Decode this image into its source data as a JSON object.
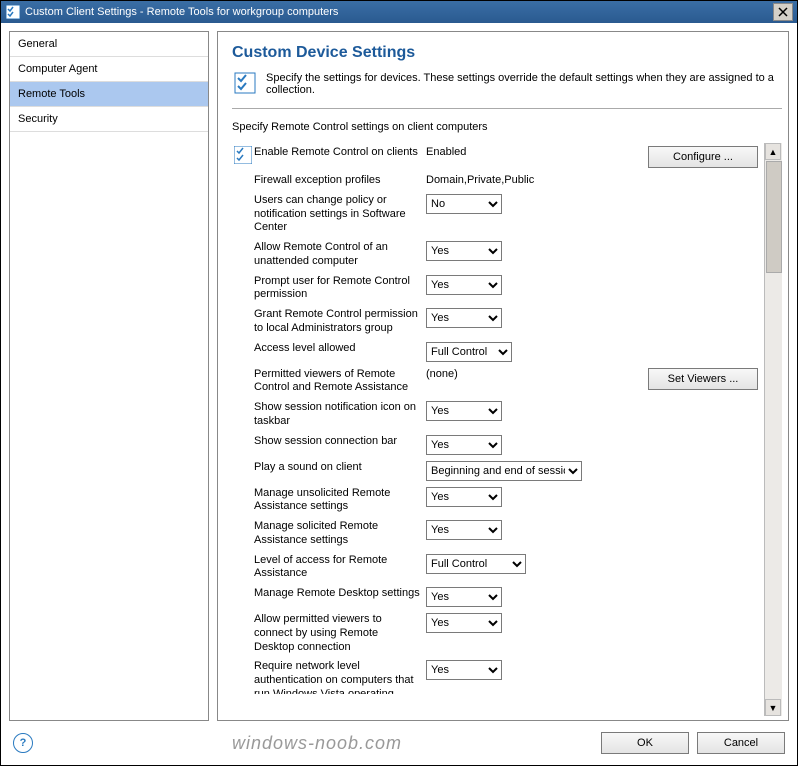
{
  "window": {
    "title": "Custom Client Settings - Remote Tools for workgroup computers"
  },
  "nav": {
    "items": [
      "General",
      "Computer Agent",
      "Remote Tools",
      "Security"
    ],
    "selected": "Remote Tools"
  },
  "content": {
    "heading": "Custom Device Settings",
    "description": "Specify the settings for devices. These settings override the default settings when they are assigned to a collection.",
    "subheading": "Specify Remote Control settings on client computers"
  },
  "settings": [
    {
      "label": "Enable Remote Control on clients",
      "value": "Enabled",
      "control": "text"
    },
    {
      "label": "Firewall exception profiles",
      "value": "Domain,Private,Public",
      "control": "text"
    },
    {
      "label": "Users can change policy or notification settings in Software Center",
      "value": "No",
      "control": "select"
    },
    {
      "label": "Allow Remote Control of an unattended computer",
      "value": "Yes",
      "control": "select"
    },
    {
      "label": "Prompt user for Remote Control permission",
      "value": "Yes",
      "control": "select"
    },
    {
      "label": "Grant Remote Control permission to local Administrators group",
      "value": "Yes",
      "control": "select"
    },
    {
      "label": "Access level allowed",
      "value": "Full Control",
      "control": "select"
    },
    {
      "label": "Permitted viewers of Remote Control and Remote Assistance",
      "value": "(none)",
      "control": "text"
    },
    {
      "label": "Show session notification icon on taskbar",
      "value": "Yes",
      "control": "select"
    },
    {
      "label": "Show session connection bar",
      "value": "Yes",
      "control": "select"
    },
    {
      "label": "Play a sound on client",
      "value": "Beginning and end of session",
      "control": "select"
    },
    {
      "label": "Manage unsolicited Remote Assistance settings",
      "value": "Yes",
      "control": "select"
    },
    {
      "label": "Manage solicited Remote Assistance settings",
      "value": "Yes",
      "control": "select"
    },
    {
      "label": "Level of access for Remote Assistance",
      "value": "Full Control",
      "control": "select"
    },
    {
      "label": "Manage Remote Desktop settings",
      "value": "Yes",
      "control": "select"
    },
    {
      "label": "Allow permitted viewers to connect by using Remote Desktop connection",
      "value": "Yes",
      "control": "select"
    },
    {
      "label": "Require network level authentication on computers that run Windows Vista operating",
      "value": "Yes",
      "control": "select"
    }
  ],
  "buttons": {
    "configure": "Configure ...",
    "set_viewers": "Set Viewers ..."
  },
  "footer": {
    "watermark": "windows-noob.com",
    "ok": "OK",
    "cancel": "Cancel"
  }
}
